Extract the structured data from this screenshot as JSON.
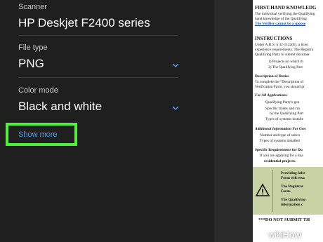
{
  "settings": {
    "scanner": {
      "label": "Scanner",
      "value": "HP Deskjet F2400 series"
    },
    "file_type": {
      "label": "File type",
      "value": "PNG"
    },
    "color_mode": {
      "label": "Color mode",
      "value": "Black and white"
    },
    "show_more_label": "Show more",
    "highlight_color": "#4ef03a",
    "link_color": "#4a9df0"
  },
  "document": {
    "lines": [
      "FIRST-HAND KNOWLEDG",
      "The individual verifying the Qualifying",
      "hand knowledge of the Qualifying",
      "The Verifier cannot be a spouse",
      "INSTRUCTIONS",
      "Under A.R.S. § 32-1122(E), a licen",
      "experience requirements. The Registra",
      "Qualifying Party to submit documer",
      "1)   Projects on which th",
      "2)   The Qualifying Part",
      "Description of Duties",
      "To complete the \"Description of",
      "Verification Form, you should pr",
      "For All Applications:",
      "Qualifying Party's gen",
      "Specific trades and cra",
      "by the Qualifying Part",
      "Types of systems installe",
      "Additional Information For Gen",
      "Number and type of subco",
      "Types of systems installed",
      "Specific Requirements for Du",
      "If you are applying for a dua",
      "residential projects.",
      "Providing false",
      "Form will resu",
      "The Registrar",
      "Form.",
      "The Qualifying",
      "information c",
      "***DO NOT SUBMIT TH"
    ]
  },
  "watermark": {
    "part1": "wiki",
    "part2": "How"
  }
}
